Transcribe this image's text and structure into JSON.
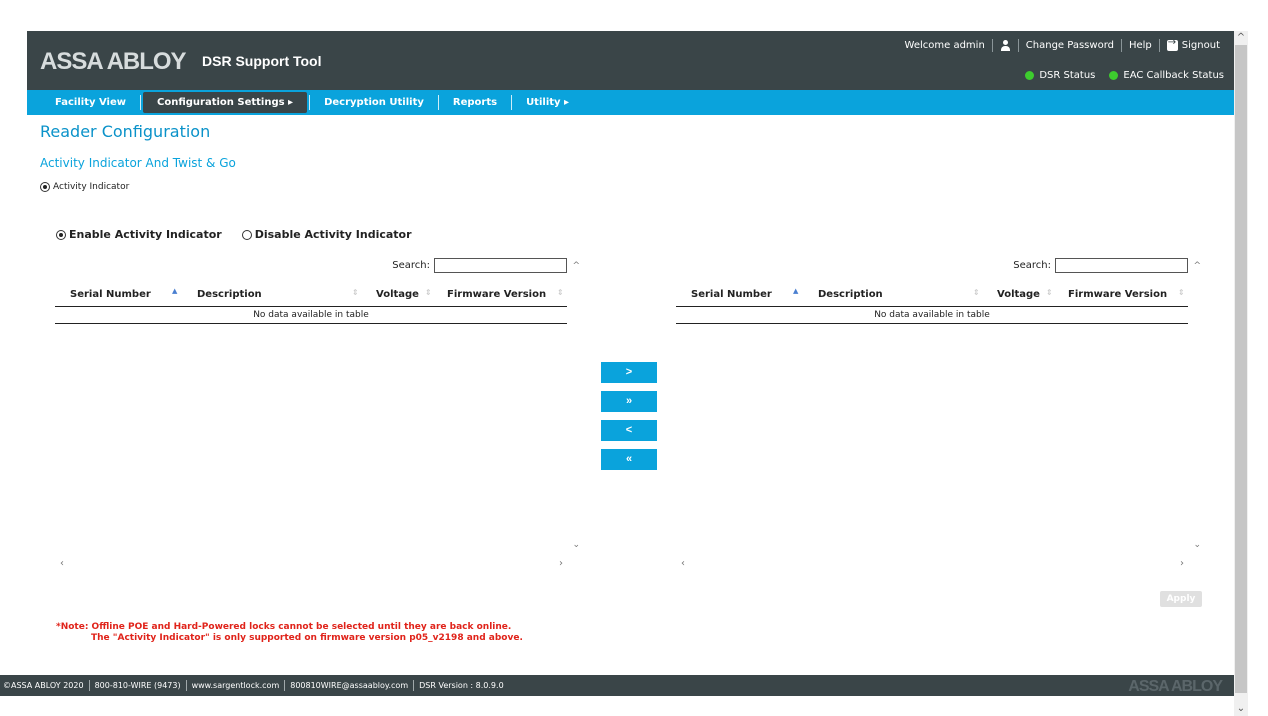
{
  "header": {
    "brand": "ASSA ABLOY",
    "product": "DSR Support Tool",
    "welcome": "Welcome admin",
    "change_password": "Change Password",
    "help": "Help",
    "signout": "Signout",
    "dsr_status": "DSR Status",
    "eac_status": "EAC Callback Status",
    "status_color": "#3dcc2e"
  },
  "nav": {
    "items": [
      {
        "label": "Facility View"
      },
      {
        "label": "Configuration Settings ▸"
      },
      {
        "label": "Decryption Utility"
      },
      {
        "label": "Reports"
      },
      {
        "label": "Utility ▸"
      }
    ]
  },
  "page": {
    "title": "Reader Configuration",
    "section": "Activity Indicator And Twist & Go",
    "activity_radio": "Activity Indicator",
    "enable_label": "Enable Activity Indicator",
    "disable_label": "Disable Activity Indicator"
  },
  "tables": {
    "search_label": "Search:",
    "columns": [
      "Serial Number",
      "Description",
      "Voltage",
      "Firmware Version"
    ],
    "empty_text": "No data available in table"
  },
  "transfer": {
    "move_one": ">",
    "move_all": "»",
    "back_one": "<",
    "back_all": "«"
  },
  "apply": "Apply",
  "note": {
    "line1": "*Note: Offline POE and Hard-Powered locks cannot be selected until they are back online.",
    "line2": "The \"Activity Indicator\" is only supported on firmware version p05_v2198 and above."
  },
  "footer": {
    "copyright": "©ASSA ABLOY 2020",
    "phone": "800-810-WIRE (9473)",
    "website": "www.sargentlock.com",
    "email": "800810WIRE@assaabloy.com",
    "version": "DSR Version : 8.0.9.0",
    "brand": "ASSA ABLOY"
  },
  "colors": {
    "header_bg": "#3a4548",
    "nav_bg": "#0aa3dc",
    "title": "#0a92c9",
    "note": "#e0231a"
  }
}
